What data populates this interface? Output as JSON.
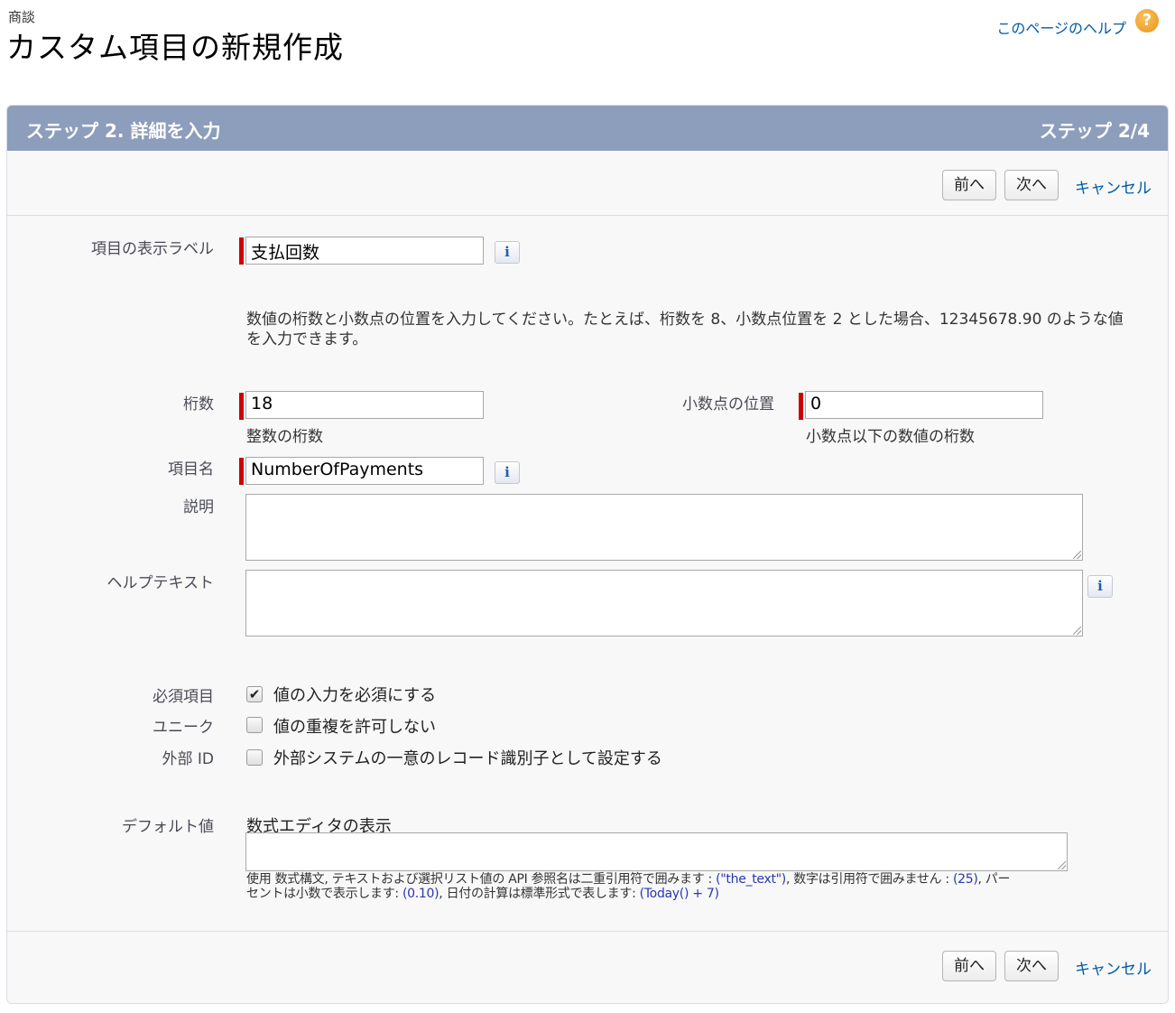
{
  "header": {
    "object_name": "商談",
    "title": "カスタム項目の新規作成",
    "help_link": "このページのヘルプ",
    "help_icon": "?"
  },
  "panel": {
    "step_title": "ステップ 2. 詳細を入力",
    "step_count": "ステップ 2/4",
    "header_color": "#8d9dbc"
  },
  "buttons": {
    "prev": "前へ",
    "next": "次へ",
    "cancel": "キャンセル"
  },
  "form": {
    "field_label": {
      "label": "項目の表示ラベル",
      "value": "支払回数"
    },
    "instructions": {
      "line1": "数値の桁数と小数点の位置を入力してください。たとえば、桁数を 8、小数点位置を 2 とした場合、12345678.90 のような値",
      "line2": "を入力できます。"
    },
    "length": {
      "label": "桁数",
      "value": "18",
      "hint": "整数の桁数"
    },
    "decimal_places": {
      "label": "小数点の位置",
      "value": "0",
      "hint": "小数点以下の数値の桁数"
    },
    "field_name": {
      "label": "項目名",
      "value": "NumberOfPayments"
    },
    "description": {
      "label": "説明",
      "value": ""
    },
    "help_text": {
      "label": "ヘルプテキスト",
      "value": ""
    },
    "required": {
      "label": "必須項目",
      "checkbox_label": "値の入力を必須にする",
      "checked": true
    },
    "unique": {
      "label": "ユニーク",
      "checkbox_label": "値の重複を許可しない",
      "checked": false
    },
    "external_id": {
      "label": "外部 ID",
      "checkbox_label": "外部システムの一意のレコード識別子として設定する",
      "checked": false
    },
    "default_value": {
      "label": "デフォルト値",
      "link": "数式エディタの表示",
      "value": "",
      "syntax": {
        "t1": "使用 ",
        "t2": "数式構文",
        "t3": ", テキストおよび選択リスト値の API 参照名は二重引用符で囲みます : ",
        "c1": "(\"the_text\")",
        "t4": ", 数字は引用符で囲みません : ",
        "c2": "(25)",
        "t5": ", パー",
        "t6": "セントは小数で表示します: ",
        "c3": "(0.10)",
        "t7": ", 日付の計算は標準形式で表します: ",
        "c4": "(Today() + 7)"
      }
    }
  },
  "icons": {
    "info": "i",
    "check": "✔"
  }
}
